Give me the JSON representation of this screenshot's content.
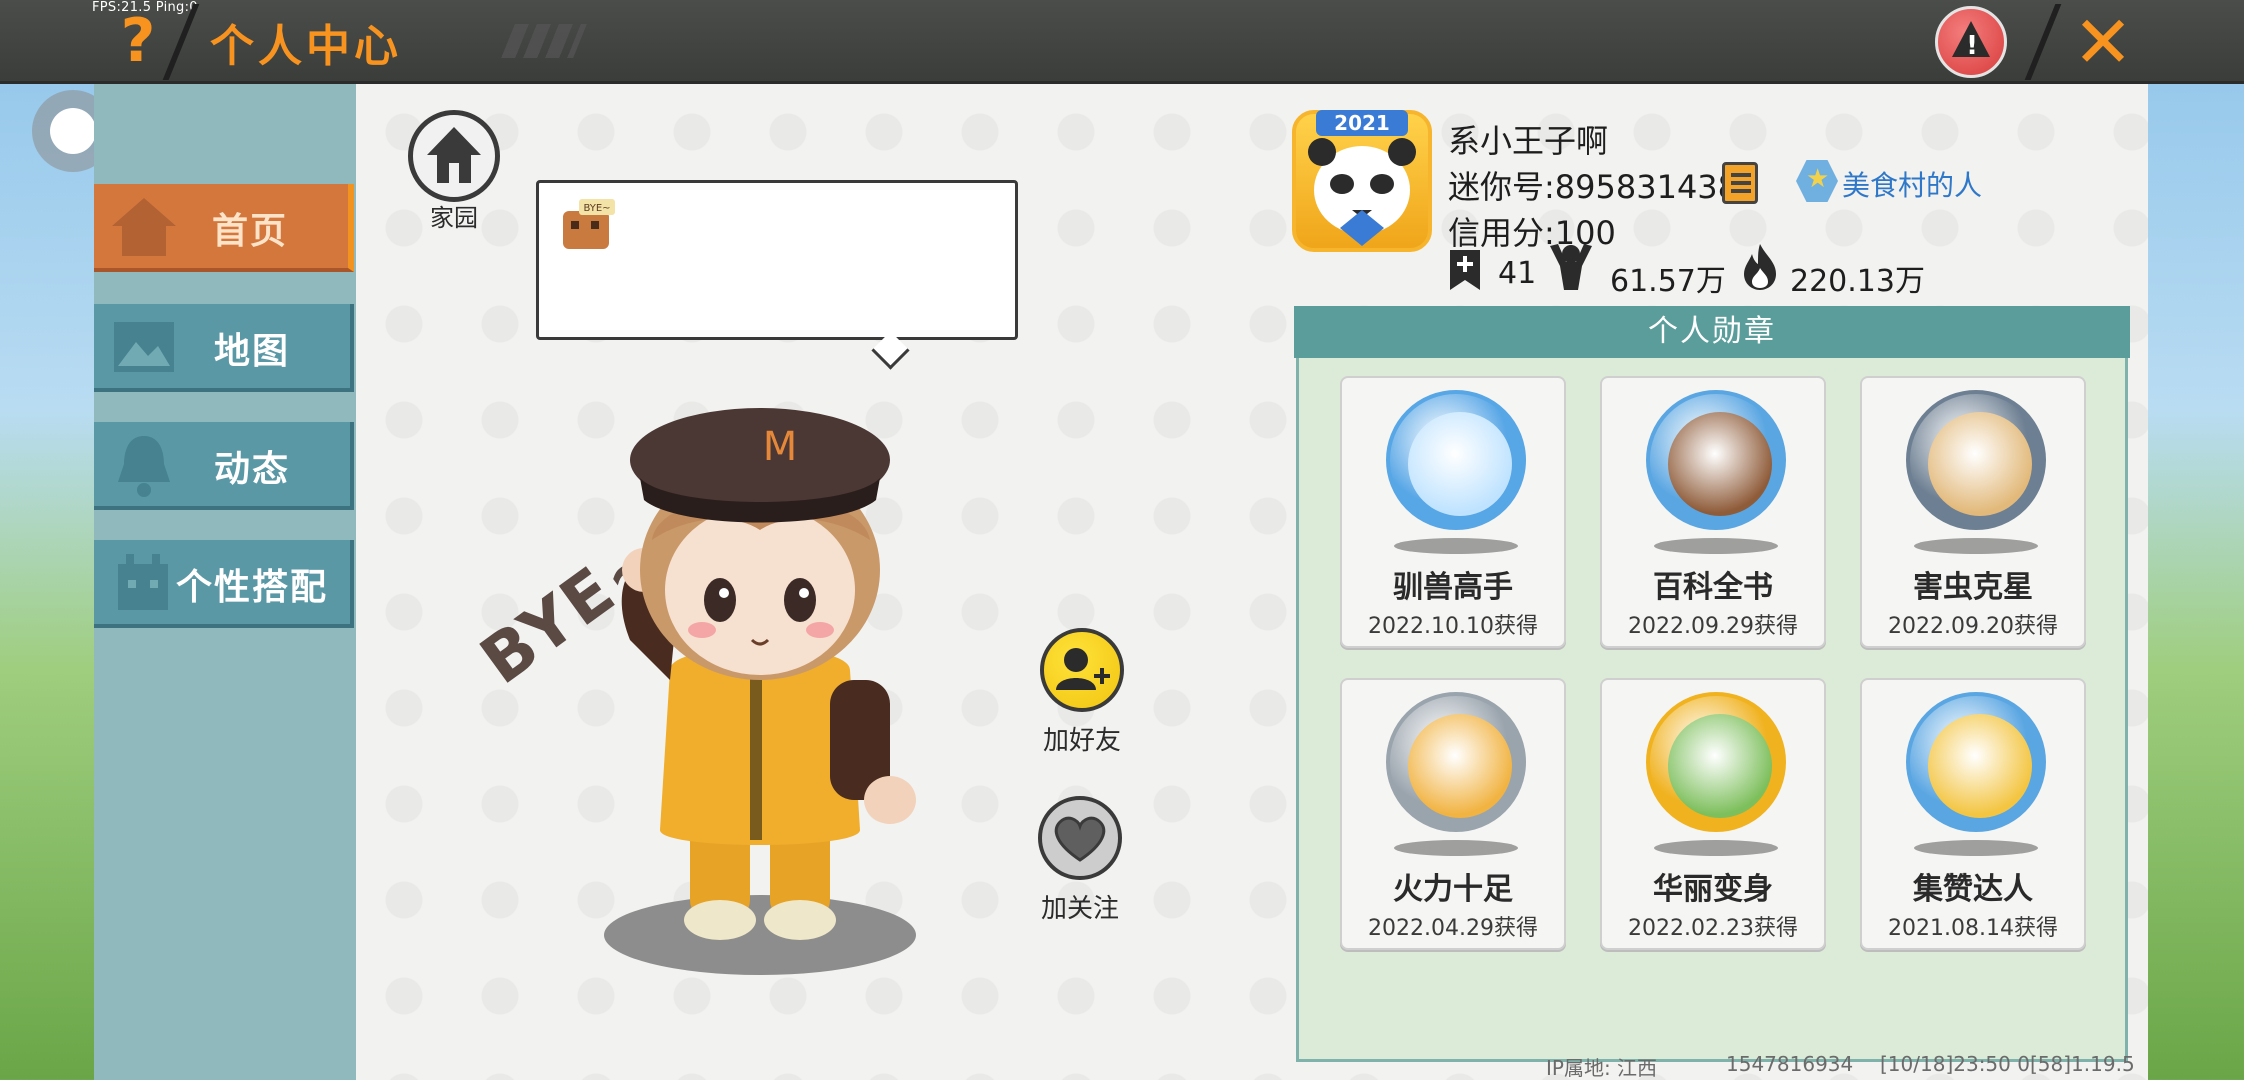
{
  "status": {
    "debug": "FPS:21.5  Ping:0"
  },
  "header": {
    "help_glyph": "?",
    "title": "个人中心",
    "close_glyph": "✕"
  },
  "sidebar": {
    "items": [
      {
        "label": "首页",
        "icon": "house-icon",
        "active": true
      },
      {
        "label": "地图",
        "icon": "map-icon",
        "active": false
      },
      {
        "label": "动态",
        "icon": "bell-icon",
        "active": false
      },
      {
        "label": "个性搭配",
        "icon": "outfit-icon",
        "active": false
      }
    ]
  },
  "home": {
    "label": "家园"
  },
  "avatar": {
    "gesture_text": "BYE~"
  },
  "actions": {
    "add_friend": "加好友",
    "follow": "加关注"
  },
  "profile": {
    "badge_year": "2021",
    "nickname": "系小王子啊",
    "mini_id": "迷你号:895831438",
    "guild": "美食村的人",
    "credit": "信用分:100",
    "stats": {
      "friends": "41",
      "fans": "61.57万",
      "popularity": "220.13万"
    }
  },
  "medals": {
    "title": "个人勋章",
    "items": [
      {
        "name": "驯兽高手",
        "date": "2022.10.10获得",
        "ring": "#57a6e6",
        "core": "#bfe3ff"
      },
      {
        "name": "百科全书",
        "date": "2022.09.29获得",
        "ring": "#5aa6e2",
        "core": "#8f5c3a"
      },
      {
        "name": "害虫克星",
        "date": "2022.09.20获得",
        "ring": "#6d7f92",
        "core": "#e2b97a"
      },
      {
        "name": "火力十足",
        "date": "2022.04.29获得",
        "ring": "#9aa4ad",
        "core": "#f1b341"
      },
      {
        "name": "华丽变身",
        "date": "2022.02.23获得",
        "ring": "#f0b21f",
        "core": "#7dbf5c"
      },
      {
        "name": "集赞达人",
        "date": "2021.08.14获得",
        "ring": "#5aa6e2",
        "core": "#f3c541"
      }
    ]
  },
  "footer": {
    "ip": "IP属地: 江西",
    "uid": "1547816934",
    "time": "[10/18]23:50 0",
    "version": "[58]1.19.5"
  },
  "colors": {
    "accent": "#f7931e",
    "nav": "#5a98a6",
    "nav_active": "#d4773d",
    "medal_header": "#5a9d9b"
  }
}
